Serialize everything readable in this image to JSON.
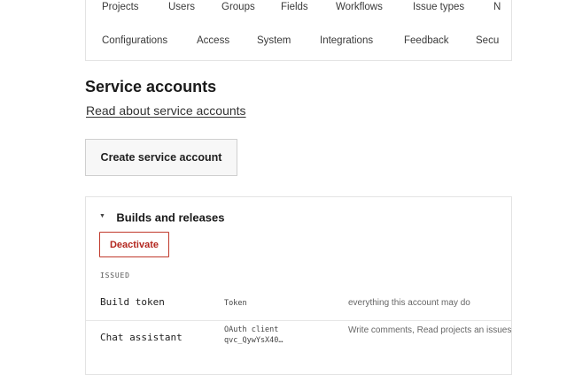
{
  "nav": {
    "row1": [
      "Projects",
      "Users",
      "Groups",
      "Fields",
      "Workflows",
      "Issue types",
      "N"
    ],
    "row2": [
      "Configurations",
      "Access",
      "System",
      "Integrations",
      "Feedback",
      "Secu"
    ]
  },
  "page": {
    "title": "Service accounts",
    "doc_link": "Read about service accounts",
    "create_button": "Create service account"
  },
  "account": {
    "title": "Builds and releases",
    "deactivate_button": "Deactivate",
    "issued_label": "ISSUED",
    "tokens": [
      {
        "name": "Build token",
        "type": "Token",
        "type_detail": "",
        "permissions": "everything this account may do"
      },
      {
        "name": "Chat assistant",
        "type": "OAuth client",
        "type_detail": "qvc_QywYsX40…",
        "permissions": "Write comments, Read projects an issues"
      }
    ]
  },
  "colors": {
    "danger": "#b3261e",
    "border": "#e3e3e3",
    "text": "#1f1f1f"
  }
}
